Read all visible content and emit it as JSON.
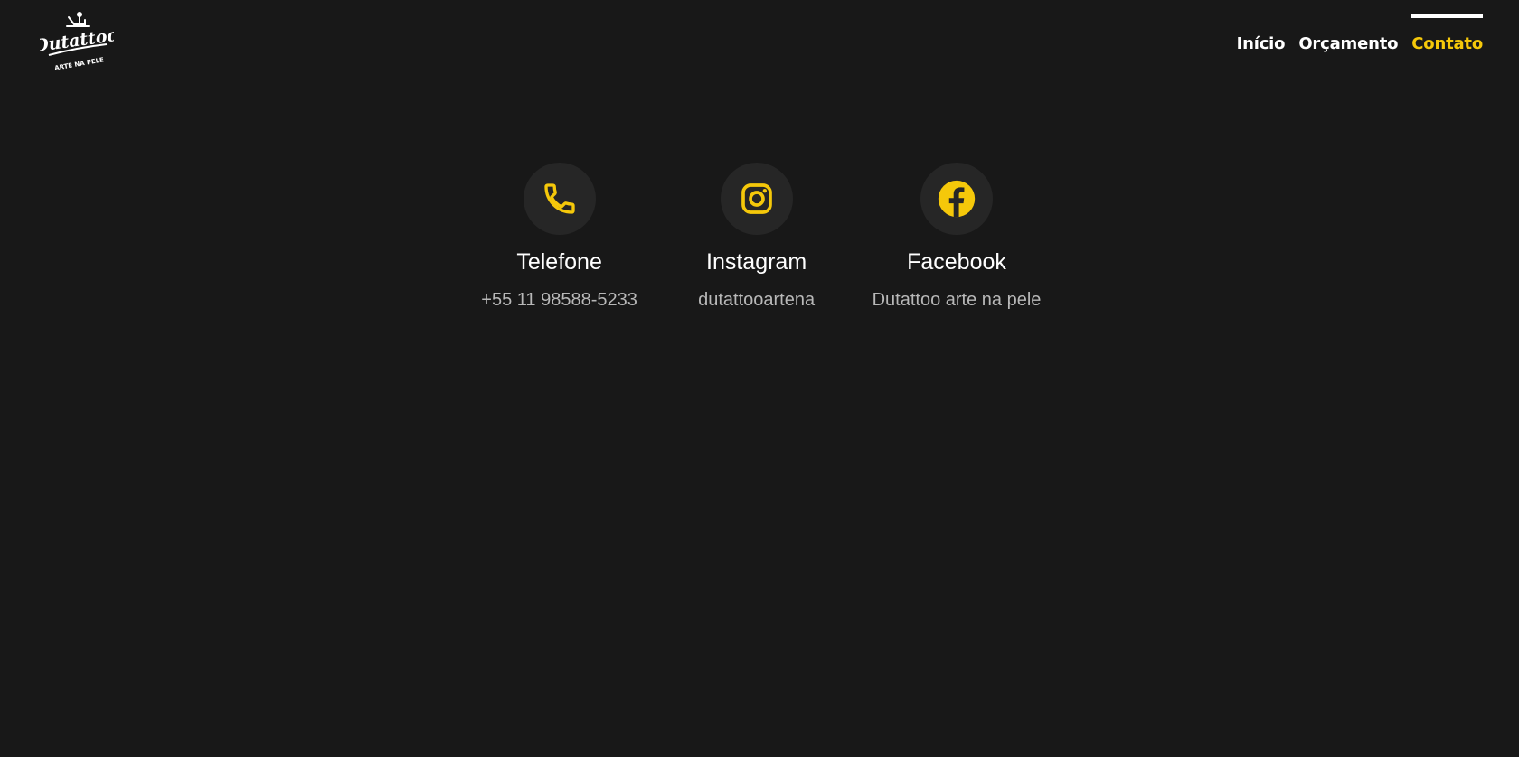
{
  "brand": {
    "logo_icon": "tattoo-machine-icon",
    "logo_wordmark": "Dutattoo",
    "logo_tagline": "ARTE NA PELE"
  },
  "nav": {
    "items": [
      {
        "label": "Início"
      },
      {
        "label": "Orçamento"
      },
      {
        "label": "Contato"
      }
    ],
    "active": "Contato"
  },
  "contacts": [
    {
      "icon": "phone-icon",
      "title": "Telefone",
      "value": "+55 11 98588-5233"
    },
    {
      "icon": "instagram-icon",
      "title": "Instagram",
      "value": "dutattooartena"
    },
    {
      "icon": "facebook-icon",
      "title": "Facebook",
      "value": "Dutattoo arte na pele"
    }
  ],
  "colors": {
    "background": "#181818",
    "accent": "#f5c80a",
    "icon_circle": "#262626",
    "text_primary": "#ffffff",
    "text_secondary": "#b8b8b8"
  }
}
